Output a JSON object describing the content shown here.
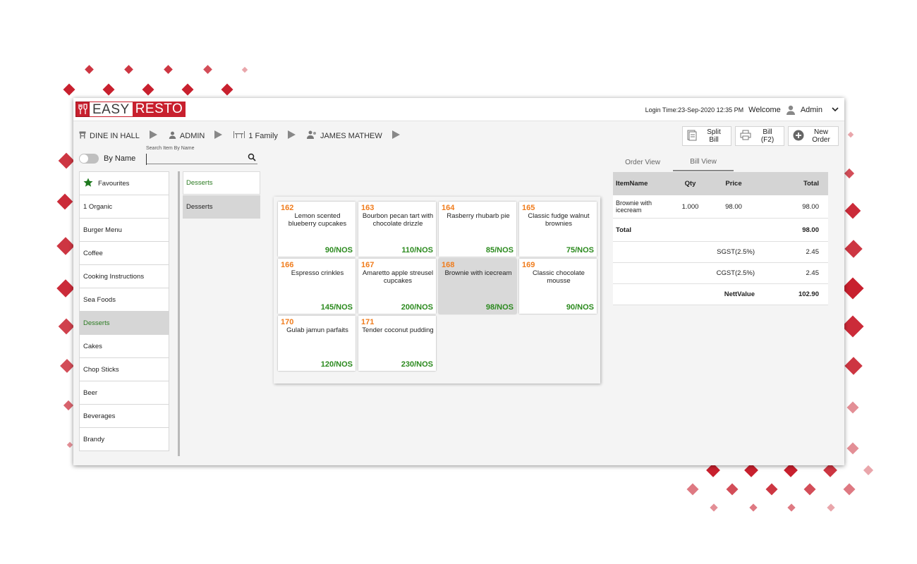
{
  "app": {
    "logo_part1": "EASY",
    "logo_part2": "RESTO",
    "brand_color": "#c8202e"
  },
  "header": {
    "login_time": "Login Time:23-Sep-2020 12:35 PM",
    "welcome": "Welcome",
    "user": "Admin",
    "user_icon": "user-icon",
    "dropdown_icon": "chevron-down-icon"
  },
  "breadcrumb": {
    "order_type": "DINE IN HALL",
    "staff": "ADMIN",
    "table": "1 Family",
    "customer": "JAMES MATHEW"
  },
  "actions": {
    "split_bill_1": "Split",
    "split_bill_2": "Bill",
    "bill_1": "Bill",
    "bill_2": "(F2)",
    "new_order_1": "New",
    "new_order_2": "Order"
  },
  "filters": {
    "by_name": "By Name",
    "search_label": "Search Item By Name",
    "search_value": ""
  },
  "categories": [
    {
      "label": "Favourites"
    },
    {
      "label": "1 Organic"
    },
    {
      "label": "Burger Menu"
    },
    {
      "label": "Coffee"
    },
    {
      "label": "Cooking Instructions"
    },
    {
      "label": "Sea Foods"
    },
    {
      "label": "Desserts"
    },
    {
      "label": "Cakes"
    },
    {
      "label": "Chop Sticks"
    },
    {
      "label": "Beer"
    },
    {
      "label": "Beverages"
    },
    {
      "label": "Brandy"
    }
  ],
  "subcategories": [
    {
      "label": "Desserts"
    },
    {
      "label": "Desserts"
    }
  ],
  "items": [
    {
      "code": "162",
      "name": "Lemon scented blueberry cupcakes",
      "price": "90/NOS"
    },
    {
      "code": "163",
      "name": "Bourbon pecan tart with chocolate drizzle",
      "price": "110/NOS"
    },
    {
      "code": "164",
      "name": "Rasberry rhubarb pie",
      "price": "85/NOS"
    },
    {
      "code": "165",
      "name": "Classic fudge walnut brownies",
      "price": "75/NOS"
    },
    {
      "code": "166",
      "name": "Espresso crinkles",
      "price": "145/NOS"
    },
    {
      "code": "167",
      "name": "Amaretto apple streusel cupcakes",
      "price": "200/NOS"
    },
    {
      "code": "168",
      "name": "Brownie with icecream",
      "price": "98/NOS"
    },
    {
      "code": "169",
      "name": "Classic chocolate mousse",
      "price": "90/NOS"
    },
    {
      "code": "170",
      "name": "Gulab jamun parfaits",
      "price": "120/NOS"
    },
    {
      "code": "171",
      "name": "Tender coconut pudding",
      "price": "230/NOS"
    }
  ],
  "views": {
    "order_view": "Order View",
    "bill_view": "Bill View"
  },
  "bill": {
    "headers": {
      "item": "ItemName",
      "qty": "Qty",
      "price": "Price",
      "total": "Total"
    },
    "rows": [
      {
        "item": "Brownie with icecream",
        "qty": "1.000",
        "price": "98.00",
        "total": "98.00"
      }
    ],
    "total_label": "Total",
    "total_value": "98.00",
    "sgst_label": "SGST(2.5%)",
    "sgst_value": "2.45",
    "cgst_label": "CGST(2.5%)",
    "cgst_value": "2.45",
    "nett_label": "NettValue",
    "nett_value": "102.90"
  }
}
